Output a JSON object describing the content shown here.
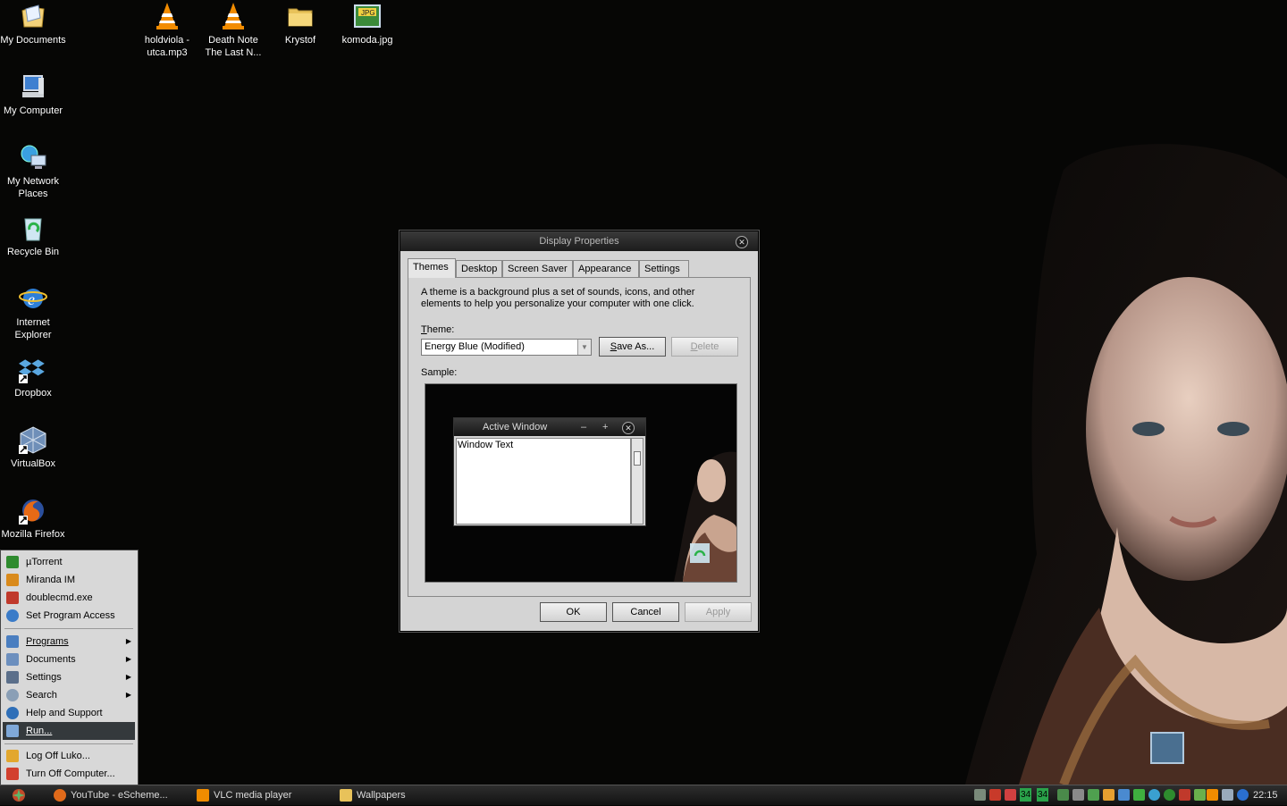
{
  "desktop": {
    "icons": [
      {
        "label": "My Documents"
      },
      {
        "label": "My Computer"
      },
      {
        "label": "My Network\nPlaces"
      },
      {
        "label": "Recycle Bin"
      },
      {
        "label": "Internet\nExplorer"
      },
      {
        "label": "Dropbox"
      },
      {
        "label": "VirtualBox"
      },
      {
        "label": "Mozilla Firefox"
      },
      {
        "label": "holdviola -\nutca.mp3"
      },
      {
        "label": "Death Note\nThe Last N..."
      },
      {
        "label": "Krystof"
      },
      {
        "label": "komoda.jpg"
      }
    ],
    "jpg_badge": "JPG"
  },
  "dialog": {
    "title": "Display Properties",
    "tabs": [
      "Themes",
      "Desktop",
      "Screen Saver",
      "Appearance",
      "Settings"
    ],
    "active_tab": "Themes",
    "description": "A theme is a background plus a set of sounds, icons, and other elements to help you personalize your computer with one click.",
    "theme_label_first": "T",
    "theme_label_rest": "heme:",
    "theme_value": "Energy Blue (Modified)",
    "save_as_first": "S",
    "save_as_rest": "ave As...",
    "delete_first": "D",
    "delete_rest": "elete",
    "sample_label": "Sample:",
    "sample": {
      "active_window_title": "Active Window",
      "window_text": "Window Text"
    },
    "ok_label": "OK",
    "cancel_label": "Cancel",
    "apply_label": "Apply"
  },
  "start_menu": {
    "pinned": [
      {
        "label": "µTorrent",
        "color": "#2e8b2e"
      },
      {
        "label": "Miranda IM",
        "color": "#d98a1c"
      },
      {
        "label": "doublecmd.exe",
        "color": "#c0392b"
      },
      {
        "label": "Set Program Access",
        "color": "#3a7bc8"
      }
    ],
    "items": [
      {
        "label": "Programs",
        "arrow": "▶"
      },
      {
        "label": "Documents",
        "arrow": "▶"
      },
      {
        "label": "Settings",
        "arrow": "▶"
      },
      {
        "label": "Search",
        "arrow": "▶"
      },
      {
        "label": "Help and Support",
        "arrow": ""
      },
      {
        "label": "Run...",
        "arrow": ""
      }
    ],
    "logoff": "Log Off Luko...",
    "turnoff": "Turn Off Computer..."
  },
  "taskbar": {
    "tasks": [
      {
        "label": "YouTube - eScheme...",
        "color": "#e06a1a"
      },
      {
        "label": "VLC media player",
        "color": "#f08c00"
      },
      {
        "label": "Wallpapers",
        "color": "#e8c25a"
      }
    ],
    "tray_numbers": [
      "34",
      "34"
    ],
    "clock": "22:15"
  }
}
